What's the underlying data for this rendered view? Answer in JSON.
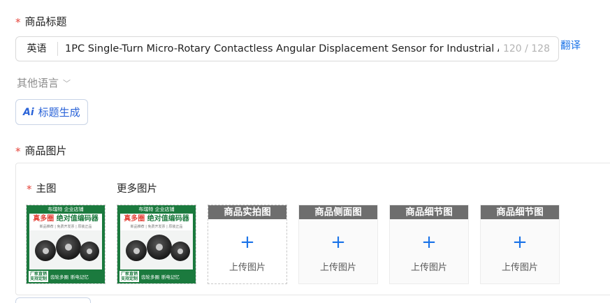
{
  "product_title": {
    "label": "商品标题",
    "required_mark": "*",
    "language": "英语",
    "value": "1PC Single-Turn Micro-Rotary Contactless Angular Displacement Sensor for Industrial A",
    "counter": "120 / 128",
    "translate_link": "翻译"
  },
  "other_languages": {
    "label": "其他语言",
    "chevron_icon": "chevron-down-icon"
  },
  "ai_button": {
    "icon_text": "Ai",
    "label": "标题生成"
  },
  "product_images": {
    "label": "商品图片",
    "required_mark": "*",
    "main_label": "主图",
    "more_label": "更多图片",
    "product_image": {
      "brand": "布瑞特 企业店铺",
      "banner_highlight": "真多圈",
      "banner_text": "绝对值编码器",
      "subline": "新品推荐 | 免费开发票 | 原装正品",
      "tag_line1": "厂家直销",
      "tag_line2": "支持定制",
      "footer_a": "齿轮多圈",
      "footer_b": "断电记忆"
    },
    "slots": [
      {
        "title": "商品实拍图",
        "upload": "上传图片"
      },
      {
        "title": "商品侧面图",
        "upload": "上传图片"
      },
      {
        "title": "商品细节图",
        "upload": "上传图片"
      },
      {
        "title": "商品细节图",
        "upload": "上传图片"
      }
    ],
    "plus_icon": "+"
  },
  "colors": {
    "accent": "#1a73e8",
    "required": "#e5443a",
    "slot_header": "#6e6e6e",
    "product_green": "#1b7a3e"
  }
}
